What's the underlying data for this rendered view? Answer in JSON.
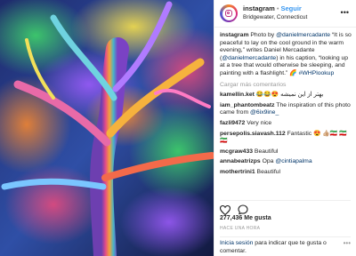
{
  "header": {
    "username": "instagram",
    "separator": "•",
    "follow_label": "Seguir",
    "location": "Bridgewater, Connecticut",
    "more_label": "•••"
  },
  "caption": {
    "username": "instagram",
    "text_a": " Photo by ",
    "mention1": "@danielmercadante",
    "text_b": " “It is so peaceful to lay on the cool ground in the warm evening,” writes Daniel Mercadante (",
    "mention2": "@danielmercadante",
    "text_c": ") in his caption, “looking up at a tree that would otherwise be sleeping, and painting with a flashlight.” 🌈",
    "hashtag": "#WHPlookup"
  },
  "load_more_label": "Cargar más comentarios",
  "comments": [
    {
      "user": "kamellin.ket",
      "text": " 😂😂😍 بهتر از این نمیشه"
    },
    {
      "user": "iam_phantombeatz",
      "text": " The inspiration of this photo came from ",
      "mention": "@6ix9ine_"
    },
    {
      "user": "fazli9472",
      "text": " Very nice"
    },
    {
      "user": "persepolis.siavash.112",
      "text": " Fantastic 😍 👍🏼🇮🇷 🇮🇷🇮🇷"
    },
    {
      "user": "mcgraw433",
      "text": " Beautiful"
    },
    {
      "user": "annabeatrizps",
      "text": " Opa ",
      "mention": "@cintiapalma"
    },
    {
      "user": "mothertrini1",
      "text": " Beautiful"
    }
  ],
  "likes": "277,436 Me gusta",
  "timestamp": "HACE UNA HORA",
  "login": {
    "link": "Inicia sesión",
    "text": " para indicar que te gusta o comentar.",
    "more": "•••"
  },
  "colors": {
    "follow_blue": "#3897f0",
    "link_navy": "#003569",
    "muted": "#999999"
  }
}
